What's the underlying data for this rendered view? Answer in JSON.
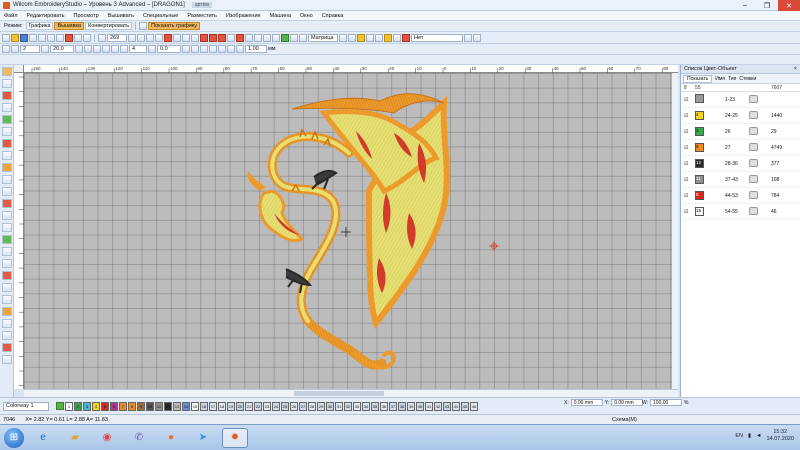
{
  "window": {
    "title": "Wilcom EmbroideryStudio – Уровень 3 Advanced – [DRAGON1]",
    "tag_chip": "артём",
    "controls": [
      "–",
      "❐",
      "✕"
    ]
  },
  "menu": [
    "Файл",
    "Редактировать",
    "Просмотр",
    "Вышивать",
    "Специальные",
    "Разместить",
    "Изображение",
    "Машина",
    "Окно",
    "Справка"
  ],
  "toolbar1": {
    "mode_label": "Режим:",
    "modes": [
      {
        "label": "Графика",
        "active": false
      },
      {
        "label": "Вышивка",
        "active": true
      },
      {
        "label": "Конвертировать",
        "active": false
      }
    ],
    "show_graphics": "Показать графику"
  },
  "toolbar2": {
    "zoom_value": "269",
    "fabric_value": "Матрица",
    "none_value": "Нет"
  },
  "toolbar3": {
    "field1": "2",
    "field2": "20.0",
    "field3": "4",
    "field4": "0.0",
    "field5": "1.00",
    "unit": "мм"
  },
  "ruler_labels": [
    "150",
    "140",
    "130",
    "120",
    "110",
    "100",
    "90",
    "80",
    "70",
    "60",
    "50",
    "40",
    "30",
    "20",
    "10",
    "0",
    "10",
    "20",
    "30",
    "40",
    "50",
    "60",
    "70",
    "80"
  ],
  "panel": {
    "title": "Список Цвет-Объект",
    "tabs": [
      "Показать",
      "Имя",
      "Тип",
      "Стежки"
    ],
    "header": {
      "col1": "8",
      "col2": "55",
      "col3": "",
      "col4": "",
      "col5": "7607"
    },
    "rows": [
      {
        "num": "",
        "color": "#9a9a9a",
        "range": "1-23",
        "stitches": ""
      },
      {
        "num": "4",
        "color": "#f2d31e",
        "range": "24-25",
        "stitches": "1440"
      },
      {
        "num": "3",
        "color": "#3aa64a",
        "range": "26",
        "stitches": "29"
      },
      {
        "num": "8",
        "color": "#f28a1e",
        "range": "27",
        "stitches": "4749"
      },
      {
        "num": "12",
        "color": "#2a2a2a",
        "range": "28-36",
        "stitches": "377"
      },
      {
        "num": "11",
        "color": "#8e8e8e",
        "range": "37-43",
        "stitches": "108"
      },
      {
        "num": "5",
        "color": "#d62a20",
        "range": "44-53",
        "stitches": "784"
      },
      {
        "num": "15",
        "color": "#f6f6f6",
        "range": "54-55",
        "stitches": "46"
      }
    ]
  },
  "palette": {
    "colorway": "Colorway 1",
    "chips": [
      {
        "n": "1",
        "c": "#ffffff"
      },
      {
        "n": "2",
        "c": "#3b9e4a"
      },
      {
        "n": "3",
        "c": "#48b7c9"
      },
      {
        "n": "4",
        "c": "#f2d31e"
      },
      {
        "n": "5",
        "c": "#d62a20"
      },
      {
        "n": "6",
        "c": "#b0358f"
      },
      {
        "n": "7",
        "c": "#e98a2c"
      },
      {
        "n": "8",
        "c": "#f28a1e"
      },
      {
        "n": "9",
        "c": "#9b6b3a"
      },
      {
        "n": "10",
        "c": "#555555"
      },
      {
        "n": "11",
        "c": "#8e8e8e"
      },
      {
        "n": "12",
        "c": "#2a2a2a"
      },
      {
        "n": "13",
        "c": "#bdbdbd"
      },
      {
        "n": "14",
        "c": "#6b8fd1"
      },
      {
        "n": "15",
        "c": "#f6f6f6"
      },
      {
        "n": "16",
        "c": "#c9d4e3"
      },
      {
        "n": "17",
        "c": "#d8e0ec"
      },
      {
        "n": "18",
        "c": "#e3e9f2"
      },
      {
        "n": "19",
        "c": "#d4dde9"
      },
      {
        "n": "20",
        "c": "#c6d1e0"
      },
      {
        "n": "21",
        "c": "#dce4ef"
      },
      {
        "n": "22",
        "c": "#cdd7e6"
      },
      {
        "n": "23",
        "c": "#e0e7f1"
      },
      {
        "n": "24",
        "c": "#d2dbe8"
      },
      {
        "n": "25",
        "c": "#c8d3e2"
      },
      {
        "n": "26",
        "c": "#dbe3ee"
      },
      {
        "n": "27",
        "c": "#cfd9e7"
      },
      {
        "n": "28",
        "c": "#e2e8f1"
      },
      {
        "n": "29",
        "c": "#d6deea"
      },
      {
        "n": "30",
        "c": "#cad5e4"
      },
      {
        "n": "31",
        "c": "#dde5ef"
      },
      {
        "n": "32",
        "c": "#d1dae7"
      },
      {
        "n": "33",
        "c": "#e4eaf3"
      },
      {
        "n": "34",
        "c": "#d7dfeb"
      },
      {
        "n": "35",
        "c": "#ccd6e5"
      },
      {
        "n": "36",
        "c": "#dfe6f0"
      },
      {
        "n": "37",
        "c": "#d3dce9"
      },
      {
        "n": "38",
        "c": "#c7d2e1"
      },
      {
        "n": "39",
        "c": "#dae2ed"
      },
      {
        "n": "40",
        "c": "#ced8e6"
      },
      {
        "n": "41",
        "c": "#e1e8f2"
      },
      {
        "n": "42",
        "c": "#d5ddea"
      },
      {
        "n": "43",
        "c": "#c9d4e3"
      },
      {
        "n": "44",
        "c": "#dce4ef"
      },
      {
        "n": "45",
        "c": "#d0d9e7"
      },
      {
        "n": "46",
        "c": "#e3e9f2"
      }
    ]
  },
  "coords": {
    "x_label": "X:",
    "x_value": "0.00 mm",
    "y_label": "Y:",
    "y_value": "0.00 mm",
    "w_label": "W:",
    "w_value": "100.00",
    "h_label": "H:",
    "h_value": "100.00",
    "pct": "%"
  },
  "status": {
    "stitch_count": "7046",
    "coords_text": "X= 2.82 Y= 0.61 L= 2.88 A= 11.83",
    "mode_text": "Схема(M)"
  },
  "taskbar": {
    "apps": [
      "ie-icon",
      "folder-icon",
      "chrome-icon",
      "viber-icon",
      "firefox-icon",
      "telegram-icon",
      "wilcom-icon"
    ],
    "lang": "EN",
    "time": "15:32",
    "date": "14.07.2020"
  },
  "colors": {
    "canvas_bg": "#bcbcbc",
    "gold": "#e9952a",
    "yellow_fill": "#e8e27a",
    "red_accent": "#d23a2a",
    "dark_claw": "#3a3a3a"
  }
}
